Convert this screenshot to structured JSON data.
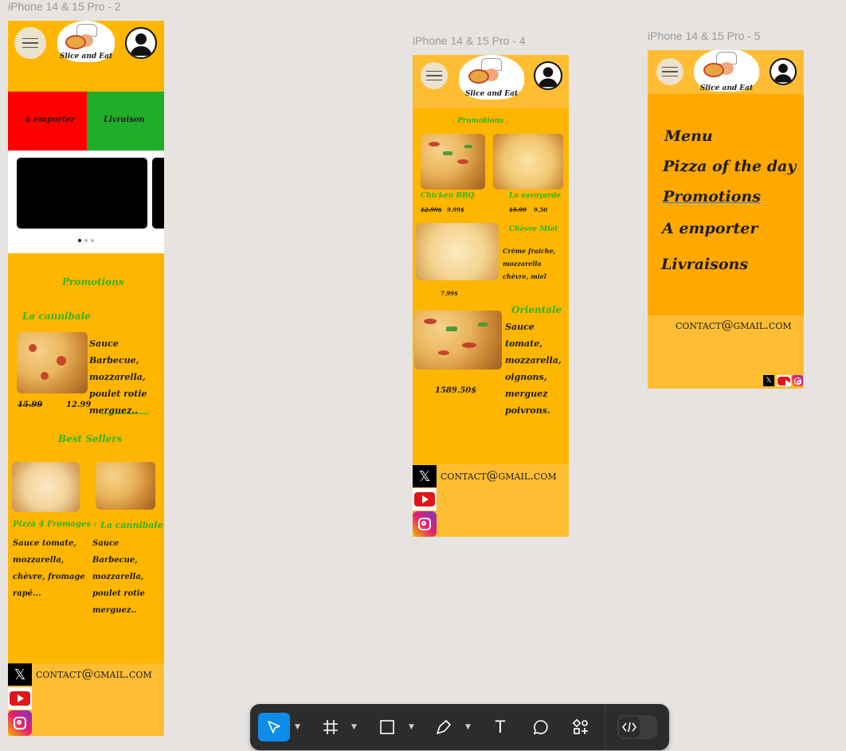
{
  "frames": {
    "f2": {
      "label": "iPhone 14 & 15 Pro - 2"
    },
    "f4": {
      "label": "iPhone 14 & 15 Pro - 4"
    },
    "f5": {
      "label": "iPhone 14 & 15 Pro - 5"
    }
  },
  "brand": {
    "name": "Slice and Eat"
  },
  "f2": {
    "btn_takeaway": "à emporter",
    "btn_delivery": "Livraison",
    "promotions_title": "Promotions",
    "promo_item": {
      "name": "La cannibale",
      "desc": "Sauce Barbecue, mozzarella, poulet rotie merguez..",
      "old_price": "15.99",
      "new_price": "12.99"
    },
    "bestsellers_title": "Best Sellers",
    "best": [
      {
        "name": "Pizza 4 Fromages :",
        "desc": "Sauce tomate, mozzarella, chèvre, fromage rapé..."
      },
      {
        "name": "La cannibale",
        "desc": "Sauce Barbecue, mozzarella, poulet rotie merguez.."
      }
    ],
    "email": "contact@gmail.com"
  },
  "f4": {
    "promotions_title": "Promotions",
    "items": [
      {
        "name": "Chicken BBQ",
        "old": "12.99$",
        "new": "9.99$"
      },
      {
        "name": "La savoyarde",
        "old": "15.99",
        "new": "9.50"
      }
    ],
    "chevre": {
      "name": "Chèvre Miel",
      "desc": "Crème fraiche, mozzarella chèvre, miel",
      "price": "7.99$"
    },
    "orientale": {
      "name": "Orientale",
      "desc": "Sauce tomate, mozzarella, oignons, merguez poivrons.",
      "price": "1589.50$"
    },
    "email": "contact@gmail.com"
  },
  "f5": {
    "menu": [
      "Menu",
      "Pizza of the day",
      "Promotions",
      "A emporter",
      "Livraisons"
    ],
    "email": "contact@gmail.com"
  },
  "colors": {
    "accent": "#ffb600",
    "green": "#2fb51c",
    "red": "#ff0000",
    "greenbtn": "#1fad2a",
    "toolbar": "#2c2c2c",
    "active": "#0d8ce9"
  },
  "toolbar": {
    "tools": [
      "move-tool",
      "frame-tool",
      "shape-tool",
      "pen-tool",
      "text-tool",
      "comment-tool",
      "actions-tool",
      "dev-mode-toggle"
    ],
    "text_tool_glyph": "T"
  }
}
